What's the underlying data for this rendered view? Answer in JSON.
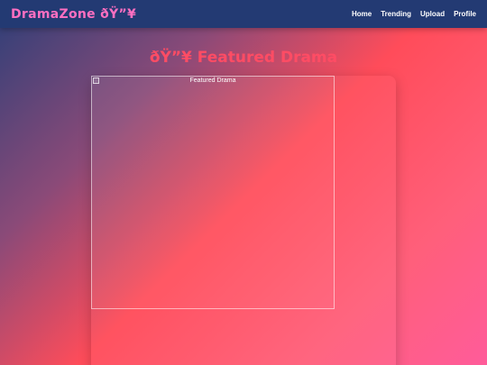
{
  "navbar": {
    "brand": "DramaZone ðŸ”¥",
    "links": [
      "Home",
      "Trending",
      "Upload",
      "Profile"
    ]
  },
  "main": {
    "heading": "ðŸ”¥ Featured Drama",
    "featured_image_alt": "Featured Drama"
  },
  "colors": {
    "navbar_bg": "#233a73",
    "brand": "#ff6fc1",
    "heading": "#ff4c64"
  }
}
